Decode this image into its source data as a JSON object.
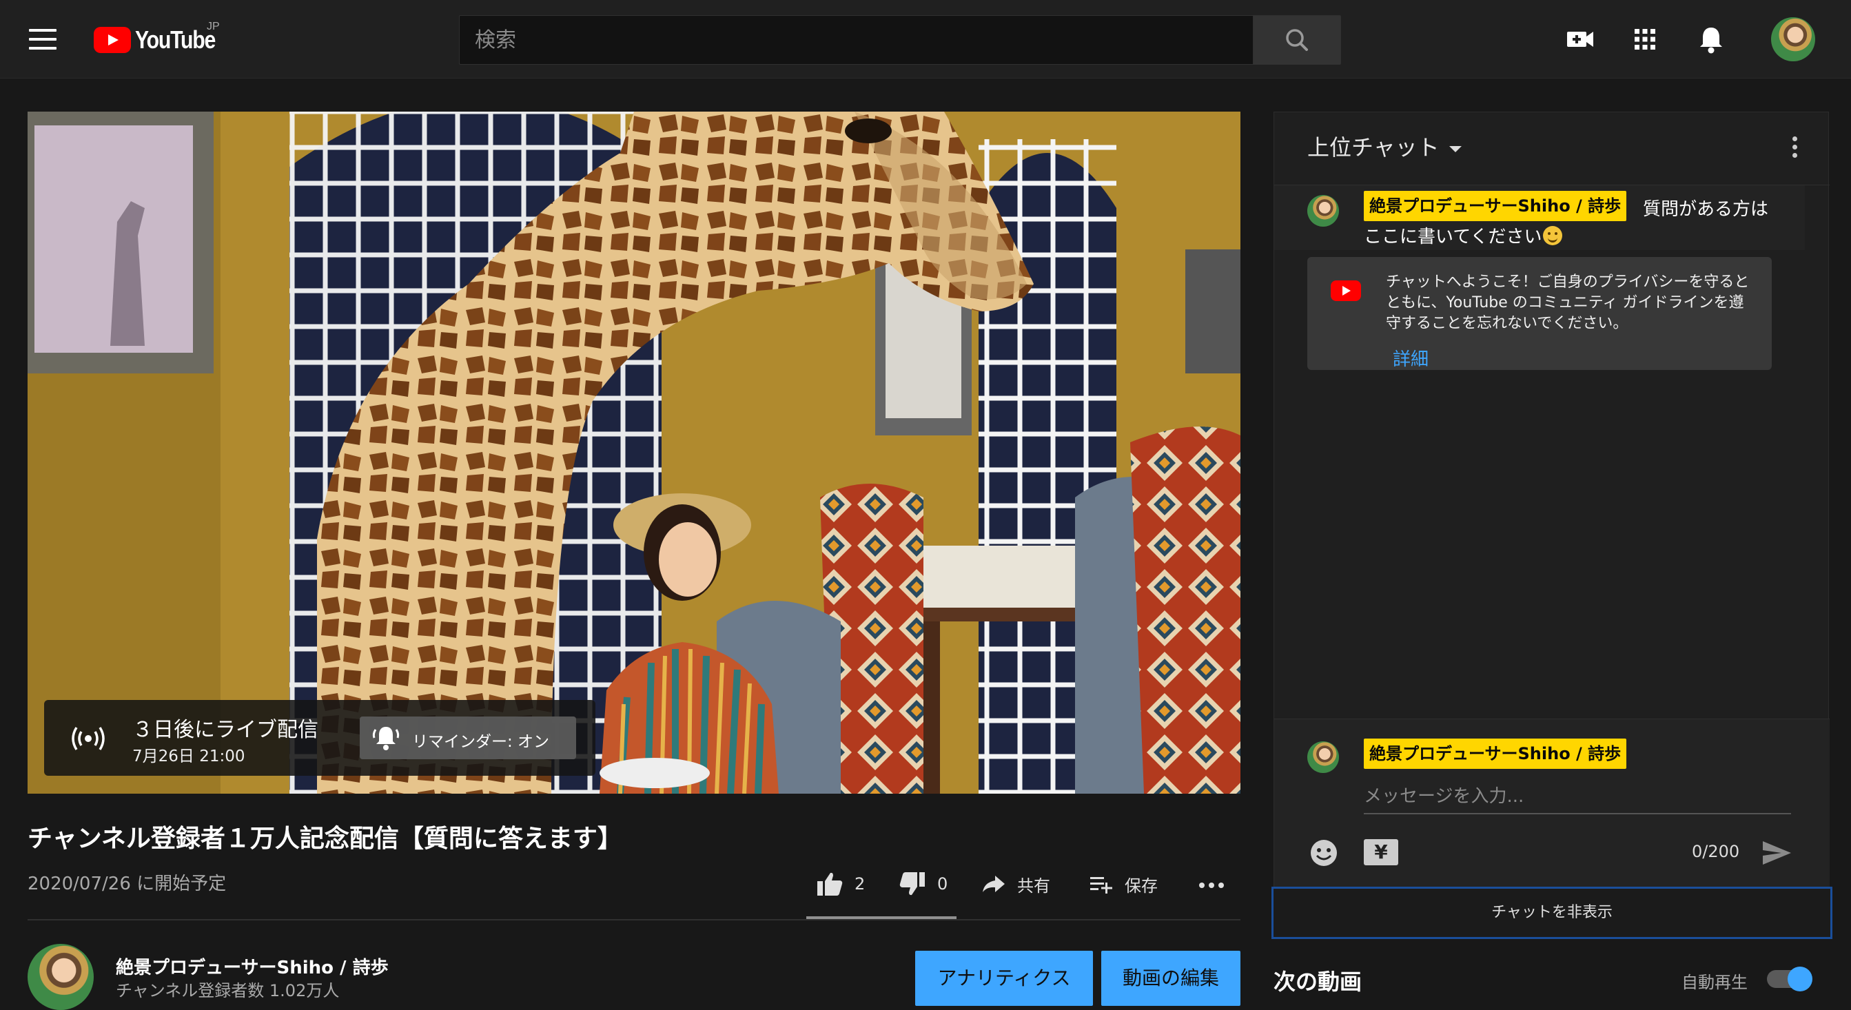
{
  "header": {
    "logo_text": "YouTube",
    "logo_region": "JP",
    "search_placeholder": "検索",
    "icons": [
      "menu-icon",
      "search-icon",
      "create-video-icon",
      "apps-icon",
      "notifications-icon",
      "avatar"
    ]
  },
  "player": {
    "live_title": "３日後にライブ配信",
    "live_date": "7月26日 21:00",
    "reminder_label": "リマインダー: オン"
  },
  "video": {
    "title": "チャンネル登録者１万人記念配信【質問に答えます】",
    "scheduled": "2020/07/26 に開始予定",
    "likes": "2",
    "dislikes": "0",
    "share_label": "共有",
    "save_label": "保存"
  },
  "channel": {
    "name": "絶景プロデューサーShiho / 詩歩",
    "subscribers": "チャンネル登録者数 1.02万人",
    "analytics_label": "アナリティクス",
    "edit_label": "動画の編集"
  },
  "chat": {
    "mode_label": "上位チャット",
    "pinned_author": "絶景プロデューサーShiho / 詩歩",
    "pinned_text_1": "質問がある方は",
    "pinned_text_2": "ここに書いてください",
    "welcome_text": "チャットへようこそ！ご自身のプライバシーを守るとともに、YouTube のコミュニティ ガイドラインを遵守することを忘れないでください。",
    "welcome_link": "詳細",
    "composer_author": "絶景プロデューサーShiho / 詩歩",
    "input_placeholder": "メッセージを入力...",
    "yen_label": "¥",
    "char_count": "0/200",
    "hide_label": "チャットを非表示"
  },
  "up_next": {
    "title": "次の動画",
    "autoplay_label": "自動再生",
    "autoplay_on": true
  },
  "colors": {
    "background": "#181818",
    "accent_blue": "#3ea6ff",
    "brand_red": "#ff0000",
    "owner_badge": "#ffd600"
  }
}
